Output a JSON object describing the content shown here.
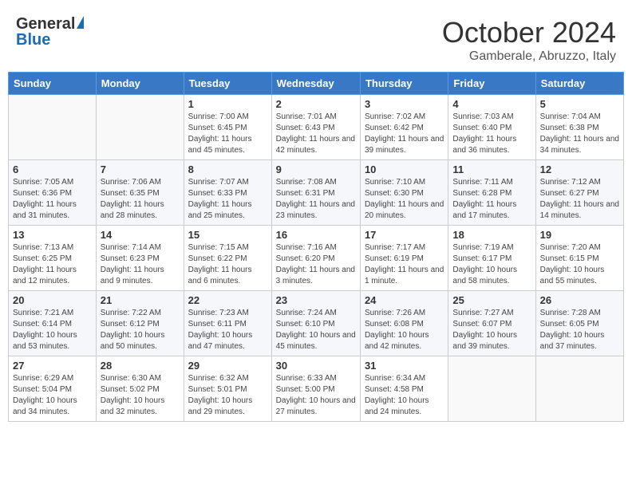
{
  "logo": {
    "general": "General",
    "blue": "Blue"
  },
  "title": {
    "month": "October 2024",
    "location": "Gamberale, Abruzzo, Italy"
  },
  "headers": [
    "Sunday",
    "Monday",
    "Tuesday",
    "Wednesday",
    "Thursday",
    "Friday",
    "Saturday"
  ],
  "weeks": [
    [
      {
        "day": "",
        "sunrise": "",
        "sunset": "",
        "daylight": ""
      },
      {
        "day": "",
        "sunrise": "",
        "sunset": "",
        "daylight": ""
      },
      {
        "day": "1",
        "sunrise": "Sunrise: 7:00 AM",
        "sunset": "Sunset: 6:45 PM",
        "daylight": "Daylight: 11 hours and 45 minutes."
      },
      {
        "day": "2",
        "sunrise": "Sunrise: 7:01 AM",
        "sunset": "Sunset: 6:43 PM",
        "daylight": "Daylight: 11 hours and 42 minutes."
      },
      {
        "day": "3",
        "sunrise": "Sunrise: 7:02 AM",
        "sunset": "Sunset: 6:42 PM",
        "daylight": "Daylight: 11 hours and 39 minutes."
      },
      {
        "day": "4",
        "sunrise": "Sunrise: 7:03 AM",
        "sunset": "Sunset: 6:40 PM",
        "daylight": "Daylight: 11 hours and 36 minutes."
      },
      {
        "day": "5",
        "sunrise": "Sunrise: 7:04 AM",
        "sunset": "Sunset: 6:38 PM",
        "daylight": "Daylight: 11 hours and 34 minutes."
      }
    ],
    [
      {
        "day": "6",
        "sunrise": "Sunrise: 7:05 AM",
        "sunset": "Sunset: 6:36 PM",
        "daylight": "Daylight: 11 hours and 31 minutes."
      },
      {
        "day": "7",
        "sunrise": "Sunrise: 7:06 AM",
        "sunset": "Sunset: 6:35 PM",
        "daylight": "Daylight: 11 hours and 28 minutes."
      },
      {
        "day": "8",
        "sunrise": "Sunrise: 7:07 AM",
        "sunset": "Sunset: 6:33 PM",
        "daylight": "Daylight: 11 hours and 25 minutes."
      },
      {
        "day": "9",
        "sunrise": "Sunrise: 7:08 AM",
        "sunset": "Sunset: 6:31 PM",
        "daylight": "Daylight: 11 hours and 23 minutes."
      },
      {
        "day": "10",
        "sunrise": "Sunrise: 7:10 AM",
        "sunset": "Sunset: 6:30 PM",
        "daylight": "Daylight: 11 hours and 20 minutes."
      },
      {
        "day": "11",
        "sunrise": "Sunrise: 7:11 AM",
        "sunset": "Sunset: 6:28 PM",
        "daylight": "Daylight: 11 hours and 17 minutes."
      },
      {
        "day": "12",
        "sunrise": "Sunrise: 7:12 AM",
        "sunset": "Sunset: 6:27 PM",
        "daylight": "Daylight: 11 hours and 14 minutes."
      }
    ],
    [
      {
        "day": "13",
        "sunrise": "Sunrise: 7:13 AM",
        "sunset": "Sunset: 6:25 PM",
        "daylight": "Daylight: 11 hours and 12 minutes."
      },
      {
        "day": "14",
        "sunrise": "Sunrise: 7:14 AM",
        "sunset": "Sunset: 6:23 PM",
        "daylight": "Daylight: 11 hours and 9 minutes."
      },
      {
        "day": "15",
        "sunrise": "Sunrise: 7:15 AM",
        "sunset": "Sunset: 6:22 PM",
        "daylight": "Daylight: 11 hours and 6 minutes."
      },
      {
        "day": "16",
        "sunrise": "Sunrise: 7:16 AM",
        "sunset": "Sunset: 6:20 PM",
        "daylight": "Daylight: 11 hours and 3 minutes."
      },
      {
        "day": "17",
        "sunrise": "Sunrise: 7:17 AM",
        "sunset": "Sunset: 6:19 PM",
        "daylight": "Daylight: 11 hours and 1 minute."
      },
      {
        "day": "18",
        "sunrise": "Sunrise: 7:19 AM",
        "sunset": "Sunset: 6:17 PM",
        "daylight": "Daylight: 10 hours and 58 minutes."
      },
      {
        "day": "19",
        "sunrise": "Sunrise: 7:20 AM",
        "sunset": "Sunset: 6:15 PM",
        "daylight": "Daylight: 10 hours and 55 minutes."
      }
    ],
    [
      {
        "day": "20",
        "sunrise": "Sunrise: 7:21 AM",
        "sunset": "Sunset: 6:14 PM",
        "daylight": "Daylight: 10 hours and 53 minutes."
      },
      {
        "day": "21",
        "sunrise": "Sunrise: 7:22 AM",
        "sunset": "Sunset: 6:12 PM",
        "daylight": "Daylight: 10 hours and 50 minutes."
      },
      {
        "day": "22",
        "sunrise": "Sunrise: 7:23 AM",
        "sunset": "Sunset: 6:11 PM",
        "daylight": "Daylight: 10 hours and 47 minutes."
      },
      {
        "day": "23",
        "sunrise": "Sunrise: 7:24 AM",
        "sunset": "Sunset: 6:10 PM",
        "daylight": "Daylight: 10 hours and 45 minutes."
      },
      {
        "day": "24",
        "sunrise": "Sunrise: 7:26 AM",
        "sunset": "Sunset: 6:08 PM",
        "daylight": "Daylight: 10 hours and 42 minutes."
      },
      {
        "day": "25",
        "sunrise": "Sunrise: 7:27 AM",
        "sunset": "Sunset: 6:07 PM",
        "daylight": "Daylight: 10 hours and 39 minutes."
      },
      {
        "day": "26",
        "sunrise": "Sunrise: 7:28 AM",
        "sunset": "Sunset: 6:05 PM",
        "daylight": "Daylight: 10 hours and 37 minutes."
      }
    ],
    [
      {
        "day": "27",
        "sunrise": "Sunrise: 6:29 AM",
        "sunset": "Sunset: 5:04 PM",
        "daylight": "Daylight: 10 hours and 34 minutes."
      },
      {
        "day": "28",
        "sunrise": "Sunrise: 6:30 AM",
        "sunset": "Sunset: 5:02 PM",
        "daylight": "Daylight: 10 hours and 32 minutes."
      },
      {
        "day": "29",
        "sunrise": "Sunrise: 6:32 AM",
        "sunset": "Sunset: 5:01 PM",
        "daylight": "Daylight: 10 hours and 29 minutes."
      },
      {
        "day": "30",
        "sunrise": "Sunrise: 6:33 AM",
        "sunset": "Sunset: 5:00 PM",
        "daylight": "Daylight: 10 hours and 27 minutes."
      },
      {
        "day": "31",
        "sunrise": "Sunrise: 6:34 AM",
        "sunset": "Sunset: 4:58 PM",
        "daylight": "Daylight: 10 hours and 24 minutes."
      },
      {
        "day": "",
        "sunrise": "",
        "sunset": "",
        "daylight": ""
      },
      {
        "day": "",
        "sunrise": "",
        "sunset": "",
        "daylight": ""
      }
    ]
  ]
}
